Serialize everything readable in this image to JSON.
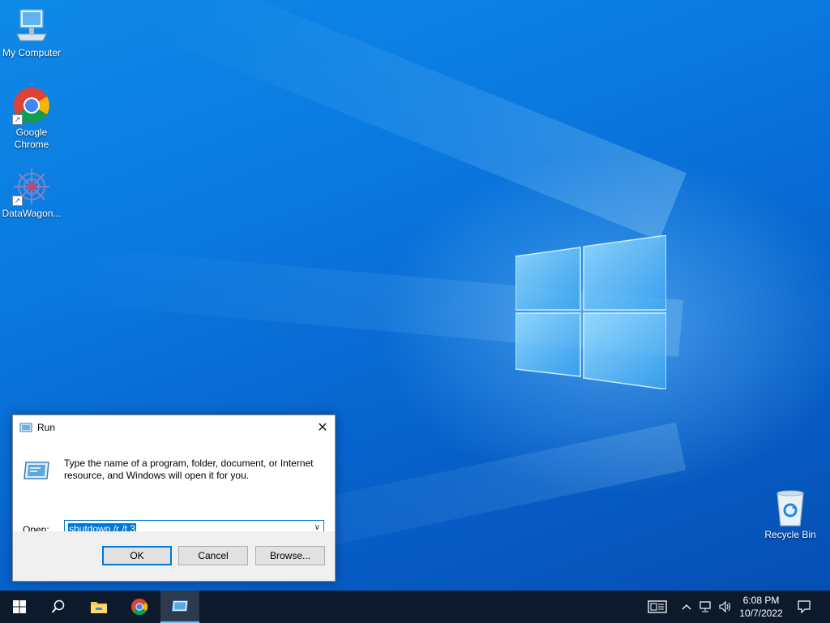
{
  "desktop": {
    "icons": [
      {
        "label": "My Computer",
        "icon": "computer-icon"
      },
      {
        "label": "Google Chrome",
        "icon": "chrome-icon"
      },
      {
        "label": "DataWagon...",
        "icon": "datawagon-icon"
      },
      {
        "label": "Recycle Bin",
        "icon": "recycle-bin-icon"
      }
    ]
  },
  "run_dialog": {
    "title": "Run",
    "description": "Type the name of a program, folder, document, or Internet resource, and Windows will open it for you.",
    "open_label": "Open:",
    "open_value": "shutdown /r /t 3",
    "buttons": {
      "ok": "OK",
      "cancel": "Cancel",
      "browse": "Browse..."
    }
  },
  "taskbar": {
    "items": [
      "start-icon",
      "search-icon",
      "file-explorer-icon",
      "chrome-icon",
      "run-icon"
    ],
    "tray_icons": [
      "news-icon",
      "chevron-up-icon",
      "network-icon",
      "volume-icon"
    ],
    "time": "6:08 PM",
    "date": "10/7/2022",
    "notification_icon": "action-center-icon"
  },
  "colors": {
    "accent": "#0078d7",
    "taskbar": "#0c1a2b",
    "desktop": "#0a6fd6"
  }
}
